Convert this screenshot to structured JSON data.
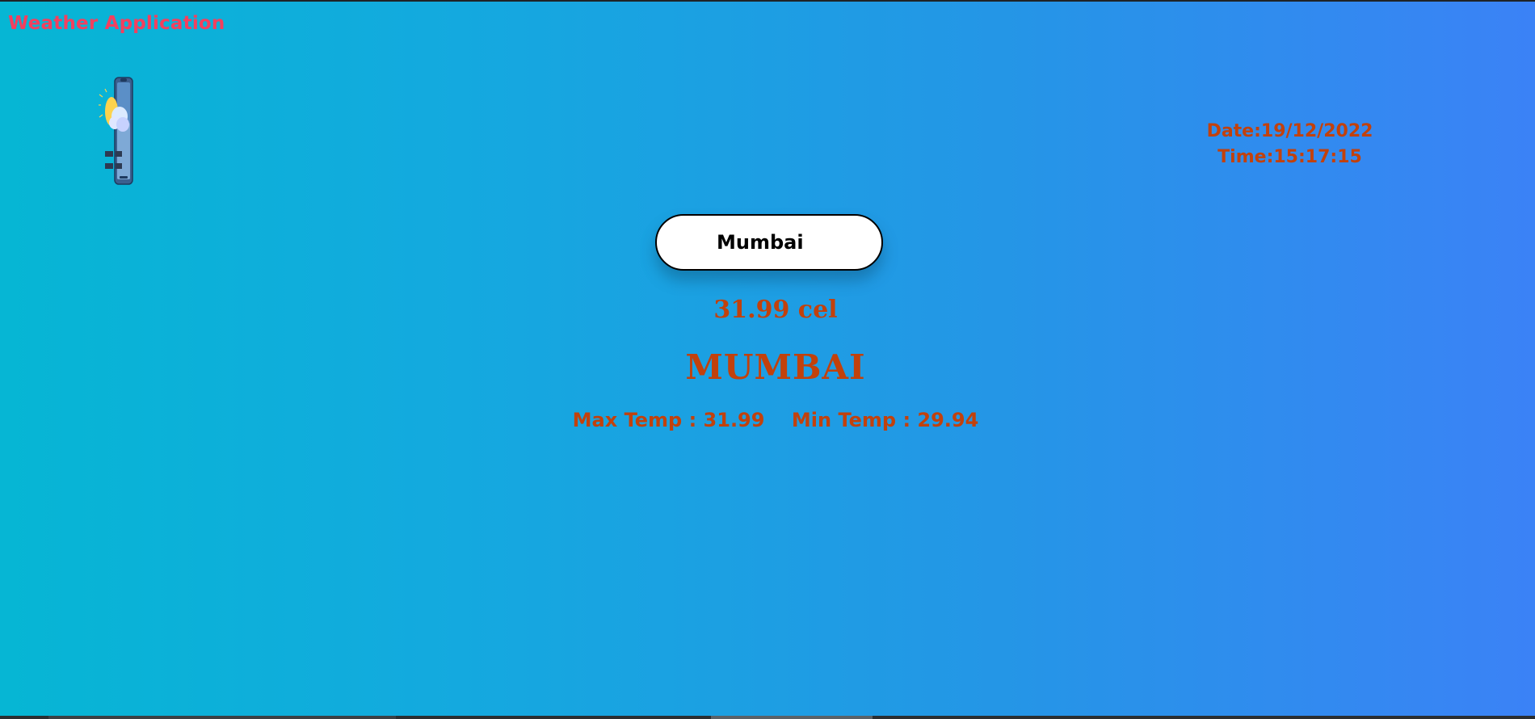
{
  "app": {
    "title": "Weather Application",
    "logo_icon": "phone-weather-icon"
  },
  "datetime": {
    "date": "Date:19/12/2022",
    "time": "Time:15:17:15"
  },
  "search": {
    "value": "Mumbai",
    "placeholder": ""
  },
  "weather": {
    "temperature": "31.99 cel",
    "city": "MUMBAI",
    "max_temp": "Max Temp : 31.99",
    "min_temp": "Min Temp : 29.94"
  },
  "colors": {
    "gradient_start": "#06b6d4",
    "gradient_end": "#3b82f6",
    "title": "#f43f5e",
    "text": "#c2410c"
  }
}
